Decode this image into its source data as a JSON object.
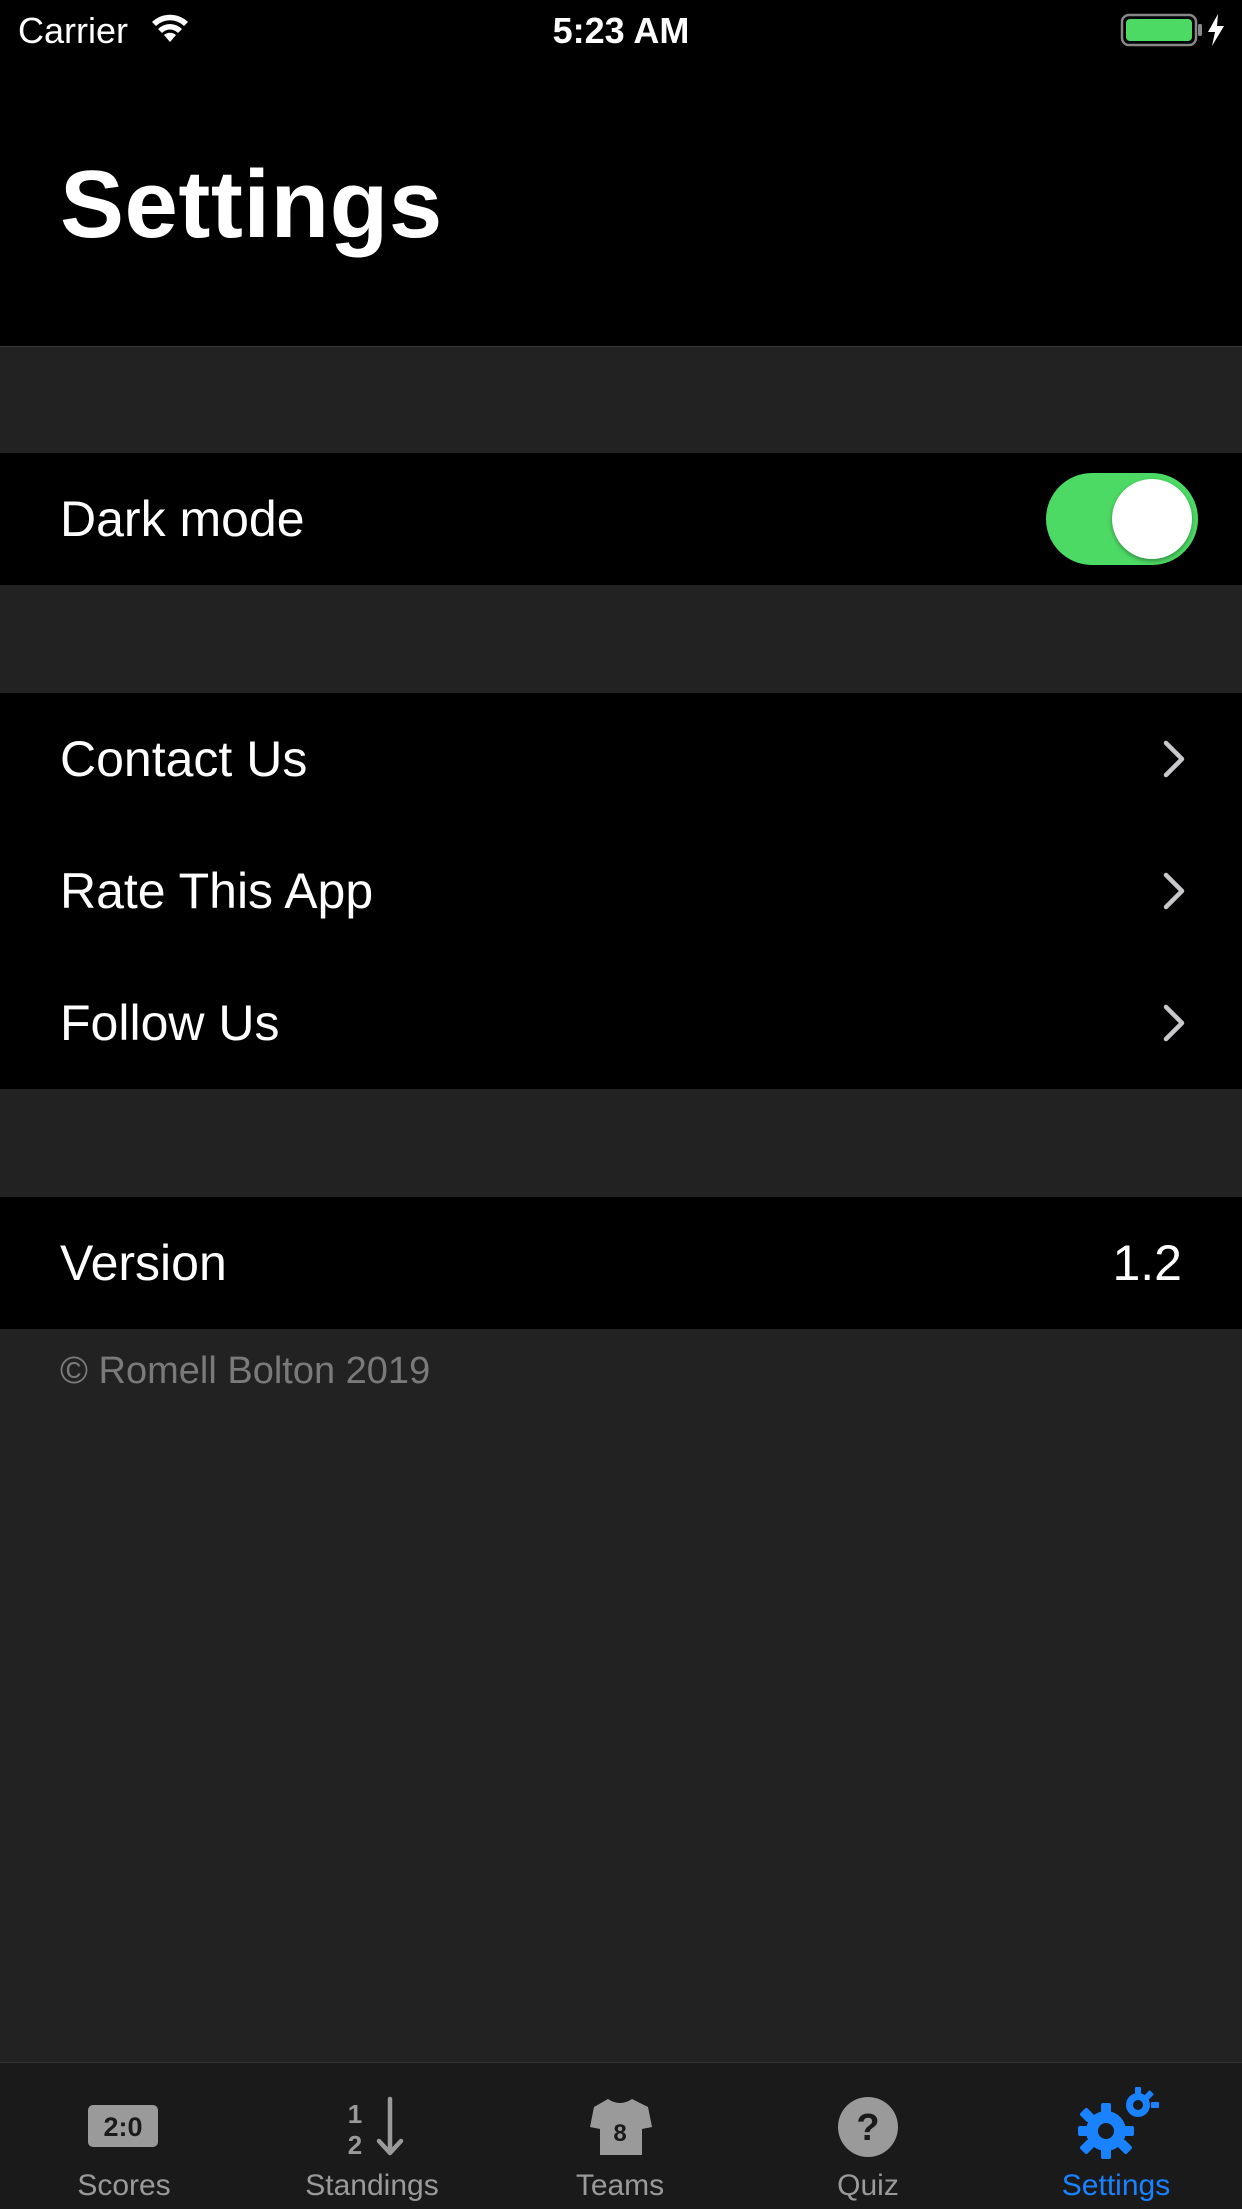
{
  "status_bar": {
    "carrier": "Carrier",
    "time": "5:23 AM"
  },
  "header": {
    "title": "Settings"
  },
  "dark_mode": {
    "label": "Dark mode",
    "enabled": true
  },
  "links": [
    {
      "label": "Contact Us"
    },
    {
      "label": "Rate This App"
    },
    {
      "label": "Follow Us"
    }
  ],
  "version": {
    "label": "Version",
    "value": "1.2"
  },
  "copyright": "© Romell Bolton 2019",
  "tabs": [
    {
      "label": "Scores",
      "icon": "scoreboard-icon",
      "active": false
    },
    {
      "label": "Standings",
      "icon": "standings-sort-icon",
      "active": false
    },
    {
      "label": "Teams",
      "icon": "jersey-icon",
      "active": false
    },
    {
      "label": "Quiz",
      "icon": "question-icon",
      "active": false
    },
    {
      "label": "Settings",
      "icon": "gears-icon",
      "active": true
    }
  ],
  "colors": {
    "accent": "#1a82ff",
    "toggle_on": "#4cd964",
    "background": "#222222"
  }
}
